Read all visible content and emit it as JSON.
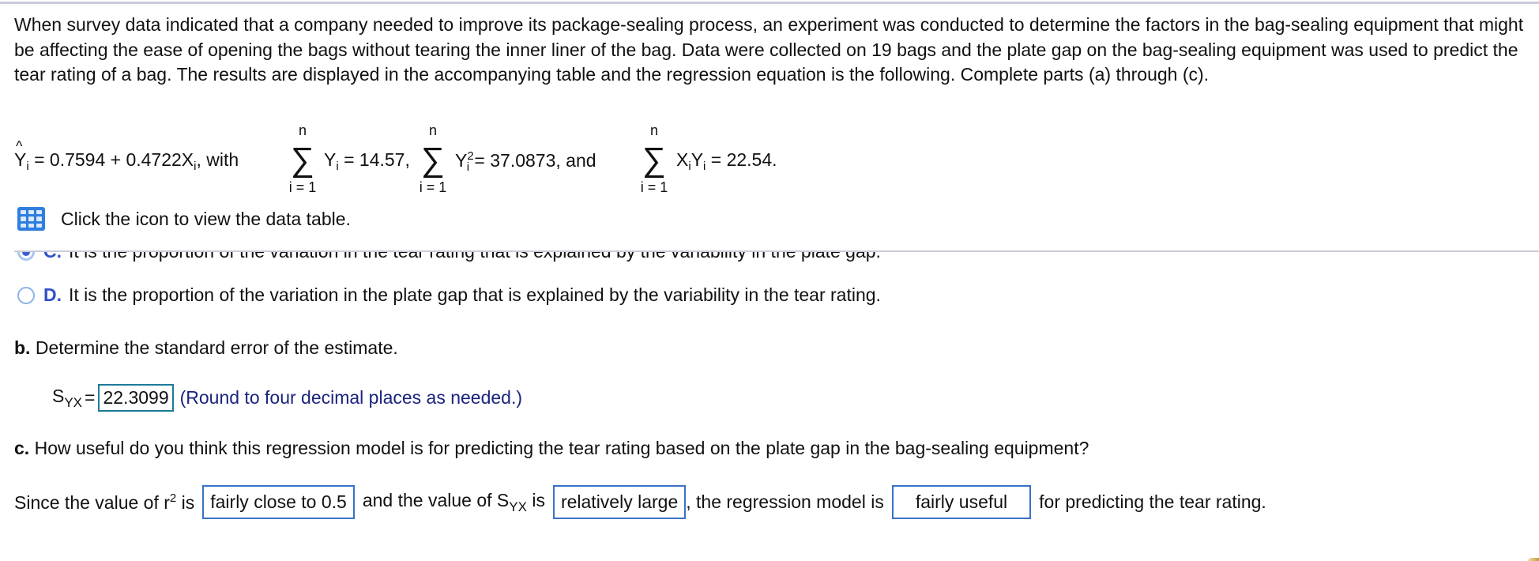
{
  "intro": "When survey data indicated that a company needed to improve its package-sealing process, an experiment was conducted to determine the factors in the bag-sealing equipment that might be affecting the ease of opening the bags without tearing the inner liner of the bag. Data were collected on 19 bags and the plate gap on the bag-sealing equipment was used to predict the tear rating of a bag. The results are displayed in the accompanying table and the regression equation is the following. Complete parts (a) through (c).",
  "formula": {
    "yhat": "Y",
    "sub_i": "i",
    "regression": "= 0.7594 + 0.4722X",
    "with": ", with",
    "sum_upper": "n",
    "sum_lower": "i = 1",
    "sigma": "∑",
    "sum1_term": "Y",
    "sum1_value": "= 14.57,",
    "sum2_term": "Y",
    "sum2_sup": "2",
    "sum2_value": "= 37.0873, and",
    "sum3_term_x": "X",
    "sum3_term_y": "Y",
    "sum3_value": "= 22.54."
  },
  "data_table_link": "Click the icon to view the data table.",
  "options": [
    {
      "letter": "C.",
      "text": "It is the proportion of the variation in the tear rating that is explained by the variability in the plate gap.",
      "selected": true
    },
    {
      "letter": "D.",
      "text": "It is the proportion of the variation in the plate gap that is explained by the variability in the tear rating.",
      "selected": false
    }
  ],
  "part_b": {
    "label": "b.",
    "question": " Determine the standard error of the estimate.",
    "syx_s": "S",
    "syx_sub": "YX",
    "equals": "=",
    "answer": "22.3099",
    "hint": "(Round to four decimal places as needed.)"
  },
  "part_c": {
    "label": "c.",
    "question": " How useful do you think this regression model is for predicting the tear rating based on the plate gap in the bag-sealing equipment?",
    "s1": "Since the value of r",
    "s1_sup": "2",
    "s1_end": " is",
    "dd1": "fairly close to 0.5",
    "s2": "and the value of S",
    "s2_sub": "YX",
    "s2_end": " is",
    "dd2": "relatively large",
    "s3": ", the regression model is",
    "dd3": "fairly useful",
    "s4": "for predicting the tear rating."
  },
  "colors": {
    "accent": "#3050c8",
    "icon_blue": "#2f7ee0",
    "answer_border": "#1f7a9a",
    "dropdown_border": "#3a72c8",
    "hint": "#1a237e",
    "separator": "#c9ccd9"
  }
}
